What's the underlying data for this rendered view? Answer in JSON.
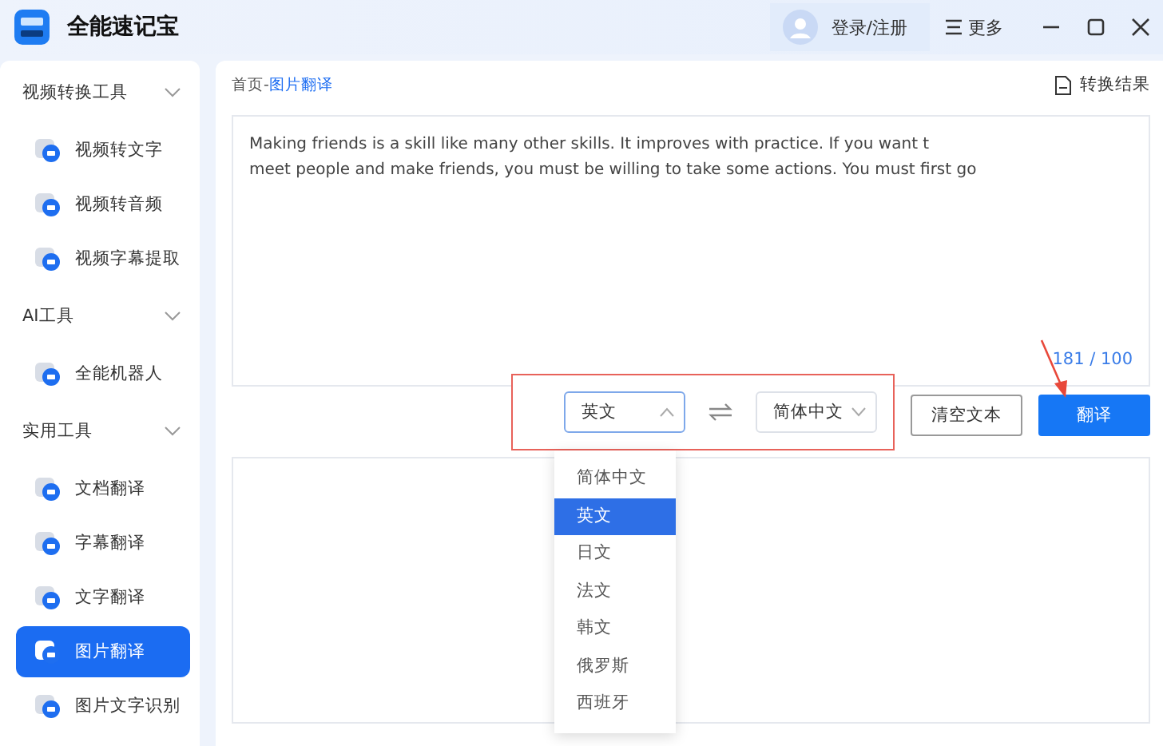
{
  "app": {
    "title": "全能速记宝"
  },
  "header": {
    "login": "登录/注册",
    "more": "更多"
  },
  "sidebar": {
    "groups": [
      {
        "label": "视频转换工具",
        "expanded": true,
        "items": [
          {
            "label": "视频转文字",
            "selected": false
          },
          {
            "label": "视频转音频",
            "selected": false
          },
          {
            "label": "视频字幕提取",
            "selected": false
          }
        ]
      },
      {
        "label": "AI工具",
        "expanded": true,
        "items": [
          {
            "label": "全能机器人",
            "selected": false
          }
        ]
      },
      {
        "label": "实用工具",
        "expanded": true,
        "items": [
          {
            "label": "文档翻译",
            "selected": false
          },
          {
            "label": "字幕翻译",
            "selected": false
          },
          {
            "label": "文字翻译",
            "selected": false
          },
          {
            "label": "图片翻译",
            "selected": true
          },
          {
            "label": "图片文字识别",
            "selected": false
          }
        ]
      }
    ]
  },
  "breadcrumb": {
    "home": "首页",
    "separator": "-",
    "current": "图片翻译"
  },
  "result_link": "转换结果",
  "input": {
    "text": "Making friends is a skill like many other skills. It improves with practice. If you want t\nmeet people and make friends, you must be willing to take some actions. You must first go",
    "count": "181 / 100"
  },
  "source_language": {
    "value": "英文",
    "expanded": true
  },
  "target_language": {
    "value": "简体中文"
  },
  "clear_button": "清空文本",
  "translate_button": "翻译",
  "dropdown": [
    {
      "label": "简体中文",
      "selected": false
    },
    {
      "label": "英文",
      "selected": true
    },
    {
      "label": "日文",
      "selected": false
    },
    {
      "label": "法文",
      "selected": false
    },
    {
      "label": "韩文",
      "selected": false
    },
    {
      "label": "俄罗斯",
      "selected": false
    },
    {
      "label": "西班牙",
      "selected": false
    }
  ]
}
